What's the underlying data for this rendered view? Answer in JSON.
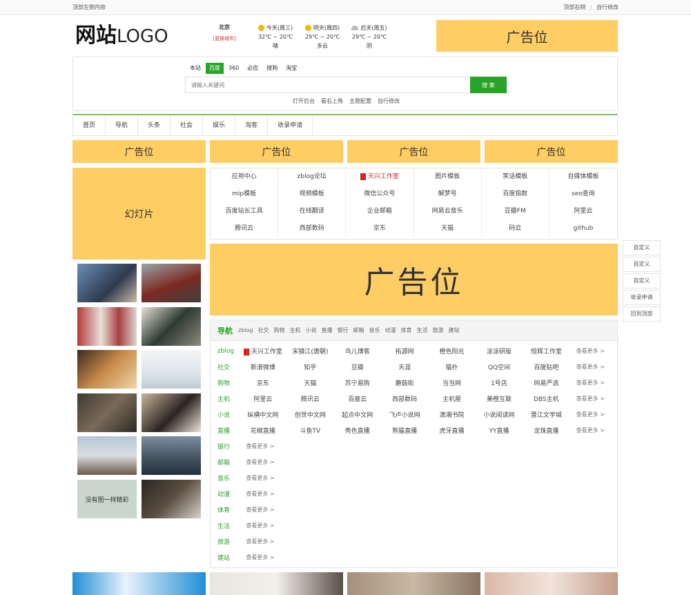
{
  "topbar": {
    "left": "顶部左侧内容",
    "right_1": "顶部右侧",
    "sep": "|",
    "right_2": "自行修改"
  },
  "logo": {
    "cn": "网站",
    "en": "LOGO"
  },
  "weather": {
    "city": "北京",
    "change": "[更换城市]",
    "days": [
      {
        "label": "今天(周三)",
        "temp": "32℃ ~ 20℃",
        "desc": "晴",
        "icon": "sun-icon"
      },
      {
        "label": "明天(周四)",
        "temp": "29℃ ~ 20℃",
        "desc": "多云",
        "icon": "sun-icon"
      },
      {
        "label": "后天(周五)",
        "temp": "29℃ ~ 20℃",
        "desc": "阴",
        "icon": "cloud-icon"
      }
    ]
  },
  "ad_label": "广告位",
  "search": {
    "tabs": [
      "本站",
      "百度",
      "360",
      "必应",
      "搜狗",
      "淘宝"
    ],
    "active_tab": "百度",
    "placeholder": "请输入关键词",
    "button": "搜 索",
    "links": [
      "打开后台",
      "看右上角",
      "主题配置",
      "自行修改"
    ]
  },
  "nav": [
    "首页",
    "导航",
    "头条",
    "社会",
    "娱乐",
    "淘客",
    "收录申请"
  ],
  "slide_label": "幻灯片",
  "thumb_caption": "没有图一样精彩",
  "links_grid": [
    [
      "应用中心",
      "zblog论坛",
      "天兴工作室",
      "图片模板",
      "笑话模板",
      "自媒体模板"
    ],
    [
      "mip模板",
      "视频模板",
      "微信公众号",
      "解梦号",
      "百度指数",
      "seo查询"
    ],
    [
      "百度站长工具",
      "在线翻译",
      "企业邮箱",
      "网易云音乐",
      "豆瓣FM",
      "阿里云"
    ],
    [
      "腾讯云",
      "西部数码",
      "京东",
      "天猫",
      "码云",
      "github"
    ]
  ],
  "side_buttons": [
    "自定义",
    "自定义",
    "自定义",
    "收录申请",
    "回到顶部"
  ],
  "cats": {
    "title": "导航",
    "tabs": [
      "zblog",
      "社交",
      "购物",
      "主机",
      "小说",
      "直播",
      "银行",
      "邮箱",
      "音乐",
      "动漫",
      "体育",
      "生活",
      "旅游",
      "建站"
    ],
    "more": "查看更多 >",
    "rows": [
      {
        "name": "zblog",
        "links": [
          "天兴工作室",
          "宋镇江(唐朝)",
          "鸟儿博客",
          "拓源网",
          "橙色阳光",
          "涂涂研版",
          "恒辉工作室"
        ]
      },
      {
        "name": "社交",
        "links": [
          "新浪微博",
          "知乎",
          "豆瓣",
          "天涯",
          "猫扑",
          "QQ空间",
          "百度贴吧"
        ]
      },
      {
        "name": "购物",
        "links": [
          "京东",
          "天猫",
          "苏宁易购",
          "蘑菇街",
          "当当网",
          "1号店",
          "网易严选"
        ]
      },
      {
        "name": "主机",
        "links": [
          "阿里云",
          "腾讯云",
          "百度云",
          "西部数码",
          "主机屋",
          "美橙互联",
          "DBS主机"
        ]
      },
      {
        "name": "小说",
        "links": [
          "纵横中文网",
          "创世中文网",
          "起点中文网",
          "飞卢小说网",
          "潇湘书院",
          "小说阅读网",
          "晋江文学城"
        ]
      },
      {
        "name": "直播",
        "links": [
          "花椒直播",
          "斗鱼TV",
          "秀色直播",
          "熊猫直播",
          "虎牙直播",
          "YY直播",
          "龙珠直播"
        ]
      },
      {
        "name": "银行",
        "links": []
      },
      {
        "name": "邮箱",
        "links": []
      },
      {
        "name": "音乐",
        "links": []
      },
      {
        "name": "动漫",
        "links": []
      },
      {
        "name": "体育",
        "links": []
      },
      {
        "name": "生活",
        "links": []
      },
      {
        "name": "旅游",
        "links": []
      },
      {
        "name": "建站",
        "links": []
      }
    ]
  },
  "colors": {
    "accent": "#2aa32a",
    "ad": "#fecd63",
    "nav_border": "#7cc15b"
  }
}
